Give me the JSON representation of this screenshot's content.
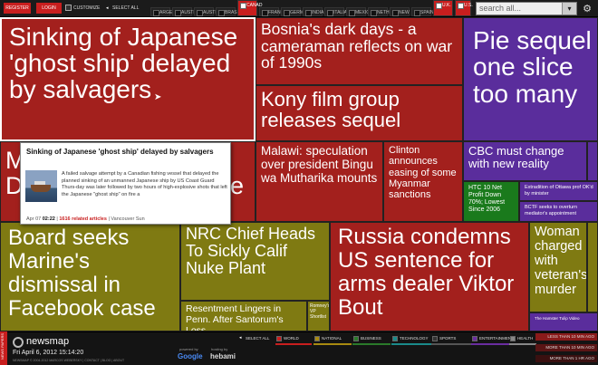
{
  "topbar": {
    "register_label": "REGISTER",
    "login_label": "LOGIN",
    "customize_label": "CUSTOMIZE",
    "select_all_label": "SELECT ALL",
    "countries": [
      "ARGEN",
      "AUSTR",
      "AUSTRI",
      "BRASIL",
      "CANAD",
      "FRANC",
      "GERMA",
      "INDIA",
      "ITALIA",
      "MEXIC",
      "NETHE",
      "NEW Z",
      "SPAIN",
      "U.K.",
      "U.S."
    ],
    "selected_countries": [
      "CANAD",
      "U.K.",
      "U.S."
    ],
    "search_placeholder": "search all..."
  },
  "tiles": [
    {
      "id": "t1",
      "headline": "Sinking of Japanese 'ghost ship' delayed by salvagers",
      "color": "#a3201d",
      "hover": true
    },
    {
      "id": "t2",
      "headline": "Bosnia's dark days - a cameraman reflects on war of 1990s",
      "color": "#a3201d"
    },
    {
      "id": "t3",
      "headline": "Kony film group releases sequel",
      "color": "#a3201d"
    },
    {
      "id": "t4",
      "headline": "Pie sequel one slice too many",
      "color": "#5a2d9c"
    },
    {
      "id": "t5",
      "headline": "M",
      "color": "#a3201d"
    },
    {
      "id": "t6",
      "headline": "D",
      "color": "#a3201d"
    },
    {
      "id": "t7",
      "headline": "e",
      "color": "#a3201d"
    },
    {
      "id": "t8",
      "headline": "Malawi: speculation over president Bingu wa Mutharika mounts",
      "color": "#a3201d"
    },
    {
      "id": "t9",
      "headline": "Clinton announces easing of some Myanmar sanctions",
      "color": "#a3201d"
    },
    {
      "id": "t10",
      "headline": "CBC must change with new reality",
      "color": "#5a2d9c"
    },
    {
      "id": "t11",
      "headline": "HTC 10 Net Profit Down 70%; Lowest Since 2006",
      "color": "#1a7a1c"
    },
    {
      "id": "t12",
      "headline": "Extradition of Ottawa prof OK'd by minister",
      "color": "#5a2d9c"
    },
    {
      "id": "t13",
      "headline": "BCTF seeks to overturn mediator's appointment",
      "color": "#5a2d9c"
    },
    {
      "id": "t14",
      "headline": "Board seeks Marine's dismissal in Facebook case",
      "color": "#7f7a12"
    },
    {
      "id": "t15",
      "headline": "NRC Chief Heads To Sickly Calif Nuke Plant",
      "color": "#7f7a12"
    },
    {
      "id": "t16",
      "headline": "Resentment Lingers in Penn. After Santorum's Loss",
      "color": "#7f7a12"
    },
    {
      "id": "t17",
      "headline": "Romney's VP Shortlist",
      "color": "#7f7a12"
    },
    {
      "id": "t18",
      "headline": "Russia condemns US sentence for arms dealer Viktor Bout",
      "color": "#a3201d"
    },
    {
      "id": "t19",
      "headline": "Woman charged with veteran's murder",
      "color": "#7f7a12"
    },
    {
      "id": "t20",
      "headline": "The Hamster Tulip Video",
      "color": "#5a2d9c"
    }
  ],
  "popup": {
    "title": "Sinking of Japanese 'ghost ship' delayed by salvagers",
    "body": "A failed salvage attempt by a Canadian fishing vessel that delayed the planned sinking of an unmanned Japanese ship by US Coast Guard Thurs-day was later followed by two hours of high-explosive shots that left the Japanese \"ghost ship\" on fire a",
    "date": "Apr 07",
    "time": "02:22",
    "related": "1616 related articles",
    "source": "Vancouver Sun"
  },
  "bottombar": {
    "side_label": "NEWS PAPERS",
    "brand": "newsmap",
    "datetime": "Fri April 6, 2012 15:14:20",
    "copyright": "NEWSMAP © 2004-2012 MARCOS WEBERSKY  |  CONTACT  |  BLOG  |  ABOUT",
    "powered_by": "powered by",
    "google": "Google",
    "hosting_by": "hosting by",
    "host": "hebami",
    "select_all_label": "SELECT ALL",
    "categories": [
      {
        "label": "WORLD",
        "color": "#c81e1e"
      },
      {
        "label": "NATIONAL",
        "color": "#a88a10"
      },
      {
        "label": "BUSINESS",
        "color": "#2a7a2a"
      },
      {
        "label": "TECHNOLOGY",
        "color": "#1a8a8a"
      },
      {
        "label": "SPORTS",
        "color": "#333333"
      },
      {
        "label": "ENTERTAINMENT",
        "color": "#6a2da0"
      },
      {
        "label": "HEALTH",
        "color": "#888888"
      }
    ],
    "legend": [
      "LESS THAN 10 MIN AGO",
      "MORE THAN 10 MIN AGO",
      "MORE THAN 1 HR AGO"
    ]
  }
}
